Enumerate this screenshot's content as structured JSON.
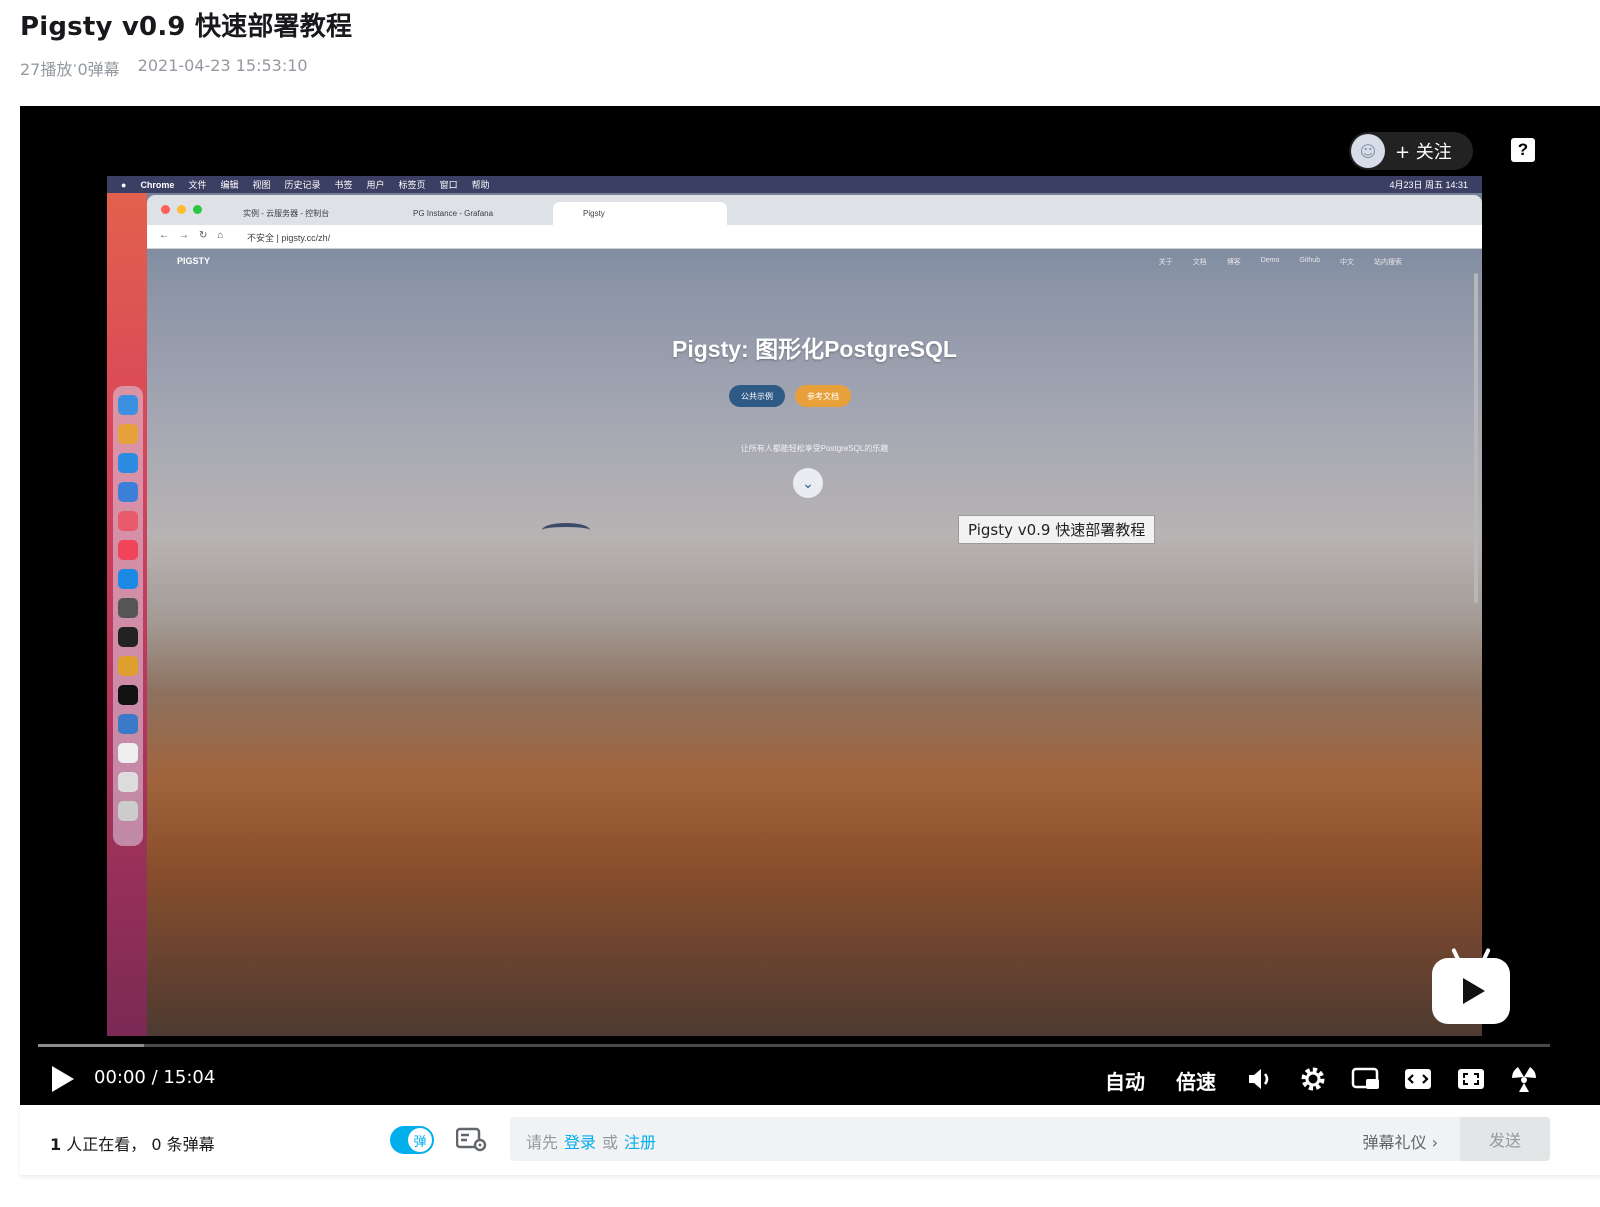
{
  "header": {
    "title": "Pigsty v0.9 快速部署教程",
    "plays": "27播放",
    "separator": " · ",
    "danmaku_count": "0弹幕",
    "date": "2021-04-23 15:53:10"
  },
  "video_frame": {
    "menubar": [
      "Chrome",
      "文件",
      "编辑",
      "视图",
      "历史记录",
      "书签",
      "用户",
      "标签页",
      "窗口",
      "帮助"
    ],
    "menubar_right": "4月23日 周五 14:31",
    "tabs": [
      "实例 - 云服务器 - 控制台",
      "PG Instance - Grafana",
      "Pigsty"
    ],
    "url": "不安全 | pigsty.cc/zh/",
    "site_logo": "PIGSTY",
    "site_nav": [
      "关于",
      "文档",
      "博客",
      "Demo",
      "Github",
      "中文",
      "站内搜索"
    ],
    "hero_title": "Pigsty: 图形化PostgreSQL",
    "btn_demo": "公共示例",
    "btn_docs": "参考文档",
    "tagline": "让所有人都能轻松享受PostgreSQL的乐趣",
    "tooltip": "Pigsty v0.9 快速部署教程"
  },
  "overlay": {
    "follow_label": "+ 关注",
    "help": "?"
  },
  "controls": {
    "current_time": "00:00",
    "time_separator": "/",
    "duration": "15:04",
    "quality": "自动",
    "speed": "倍速",
    "progress_buffered": 0.07
  },
  "bottom": {
    "viewers_count": "1",
    "viewers_text": " 人正在看，",
    "danmaku_count": "0",
    "danmaku_text": " 条弹幕",
    "toggle_label": "弹",
    "input_prefix": "请先",
    "login": "登录",
    "or": "或",
    "register": "注册",
    "etiquette": "弹幕礼仪 ›",
    "send": "发送"
  },
  "colors": {
    "accent": "#00aeec",
    "player_bg": "#000000"
  }
}
